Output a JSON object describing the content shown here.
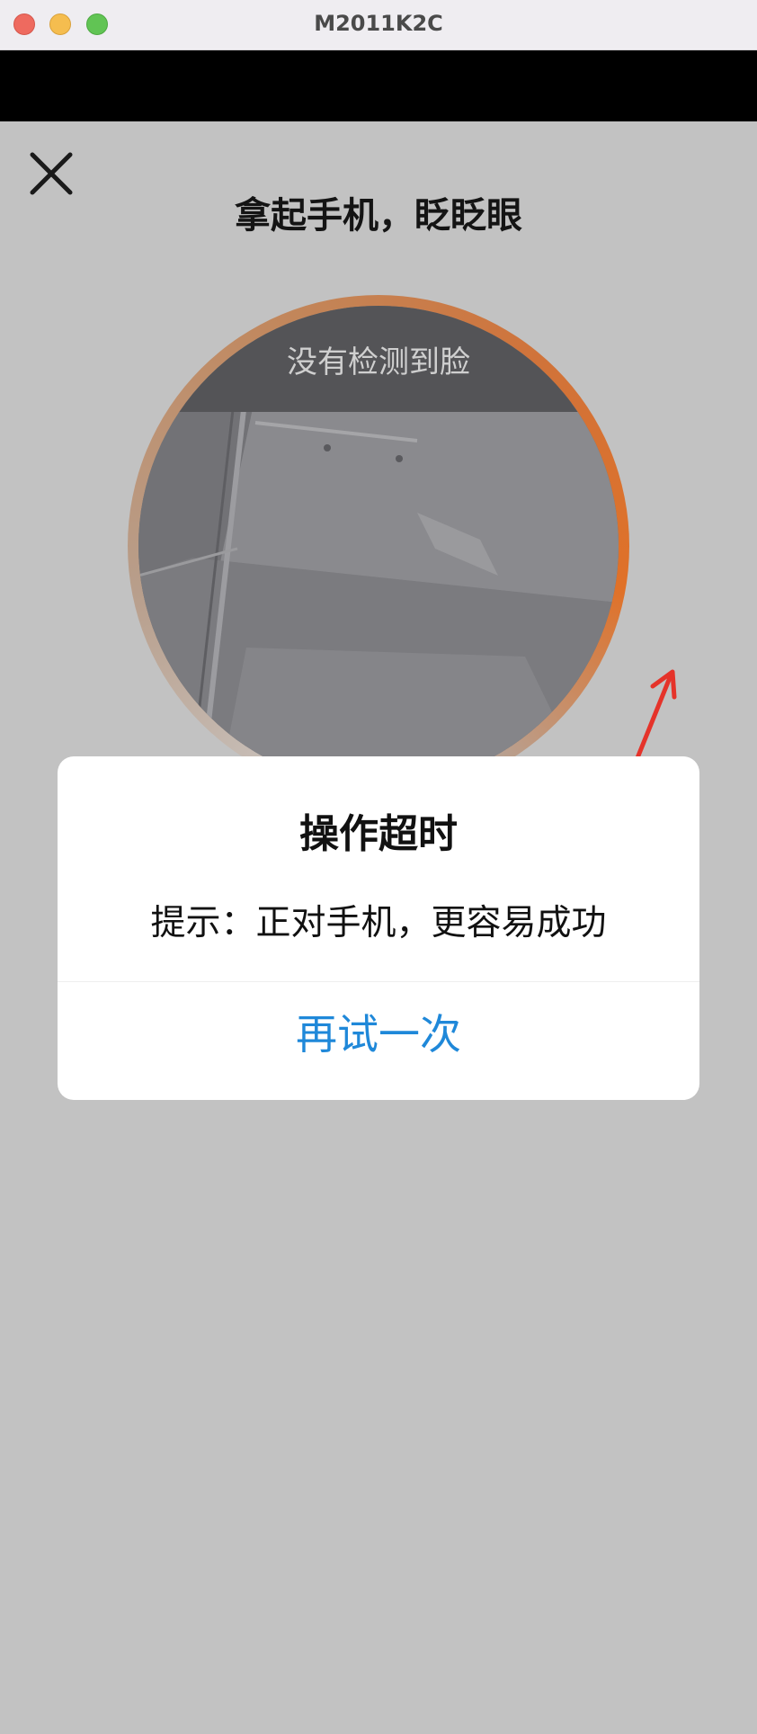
{
  "window": {
    "title": "M2011K2C"
  },
  "screen": {
    "close_icon": "close-icon",
    "title": "拿起手机，眨眨眼",
    "camera_hint": "没有检测到脸",
    "ring_colors": [
      "#c9c2bd",
      "#c2865a",
      "#e07128"
    ]
  },
  "dialog": {
    "title": "操作超时",
    "message": "提示：正对手机，更容易成功",
    "retry_label": "再试一次",
    "accent_color": "#1f88d9"
  },
  "annotation": {
    "arrow_icon": "red-arrow-icon",
    "color": "#e5332a"
  }
}
